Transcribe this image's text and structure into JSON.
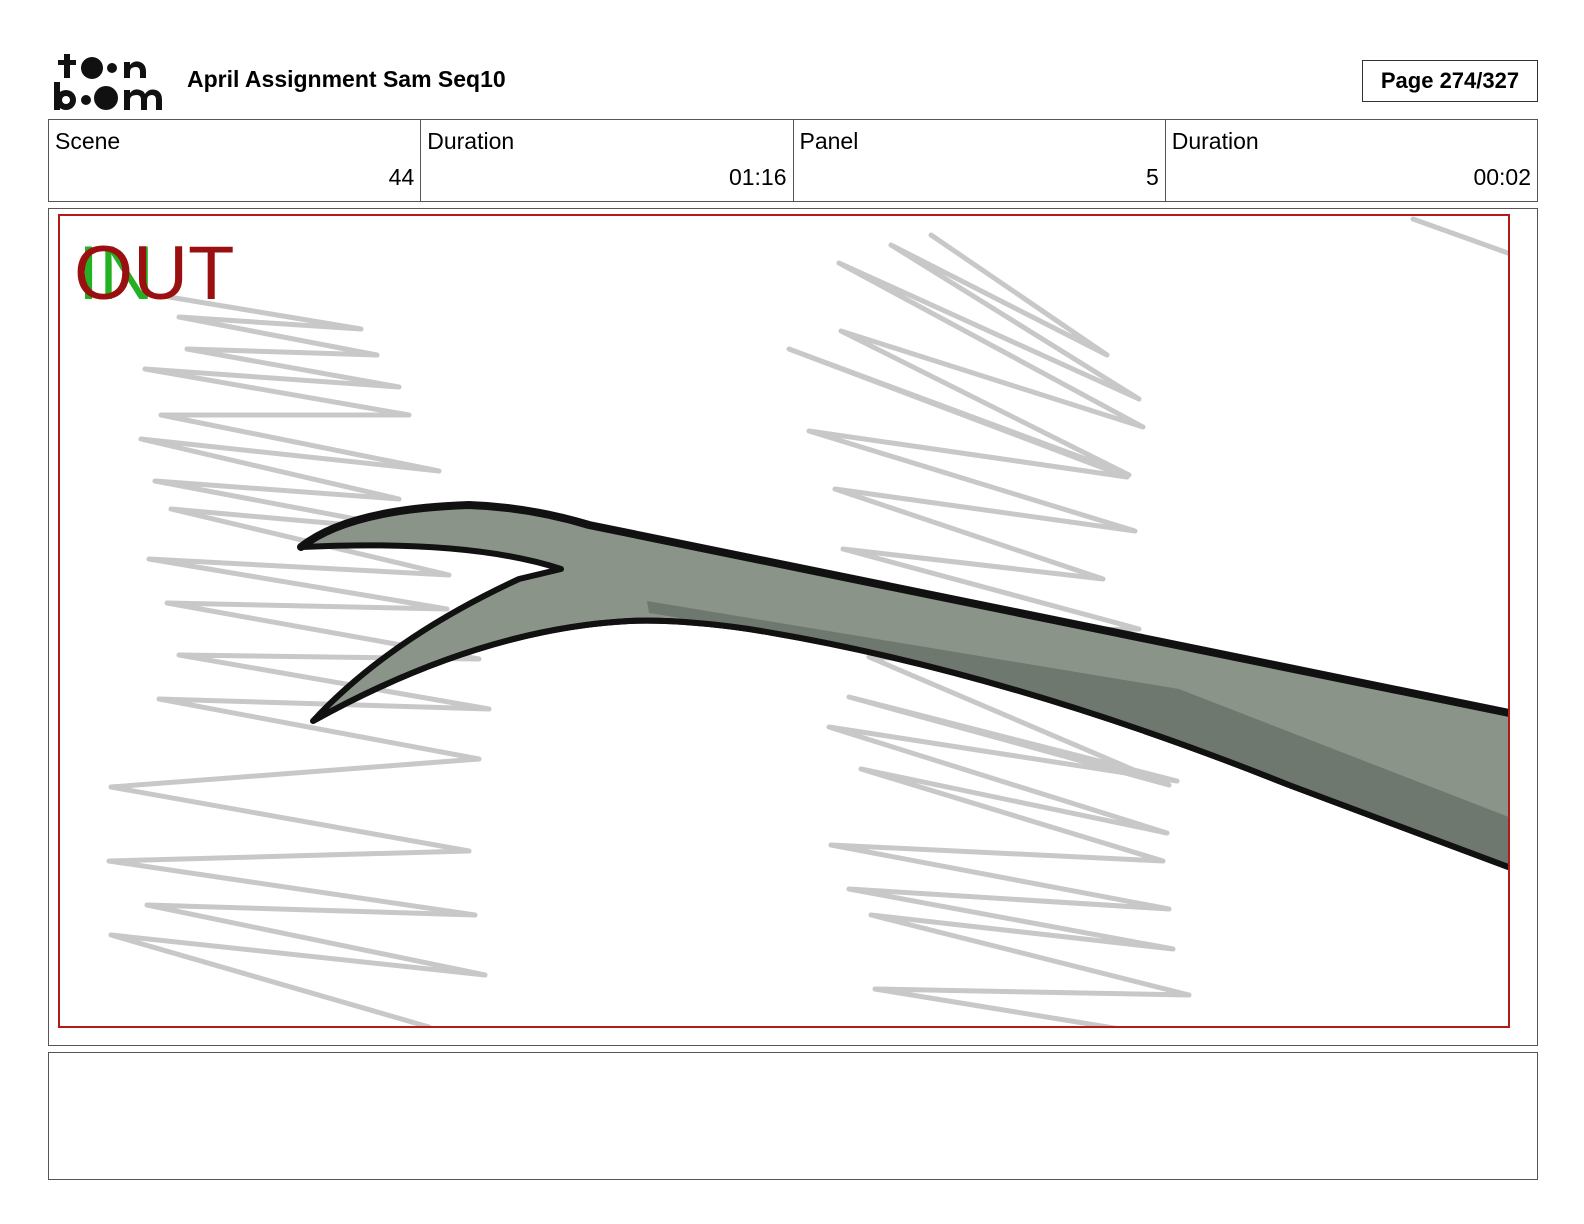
{
  "header": {
    "logo_text": "toon boom",
    "title": "April Assignment Sam Seq10",
    "page": "Page 274/327"
  },
  "info": [
    {
      "label": "Scene",
      "value": "44"
    },
    {
      "label": "Duration",
      "value": "01:16"
    },
    {
      "label": "Panel",
      "value": "5"
    },
    {
      "label": "Duration",
      "value": "00:02"
    }
  ],
  "panel": {
    "in_label": "IN",
    "out_label": "OUT",
    "colors": {
      "in": "#23b023",
      "out": "#9a1010",
      "frame": "#b01c1c",
      "branch": "#8a9488",
      "branch_shadow": "#6f786e",
      "scribble": "#c8c8c8"
    }
  },
  "notes": {
    "text": ""
  }
}
